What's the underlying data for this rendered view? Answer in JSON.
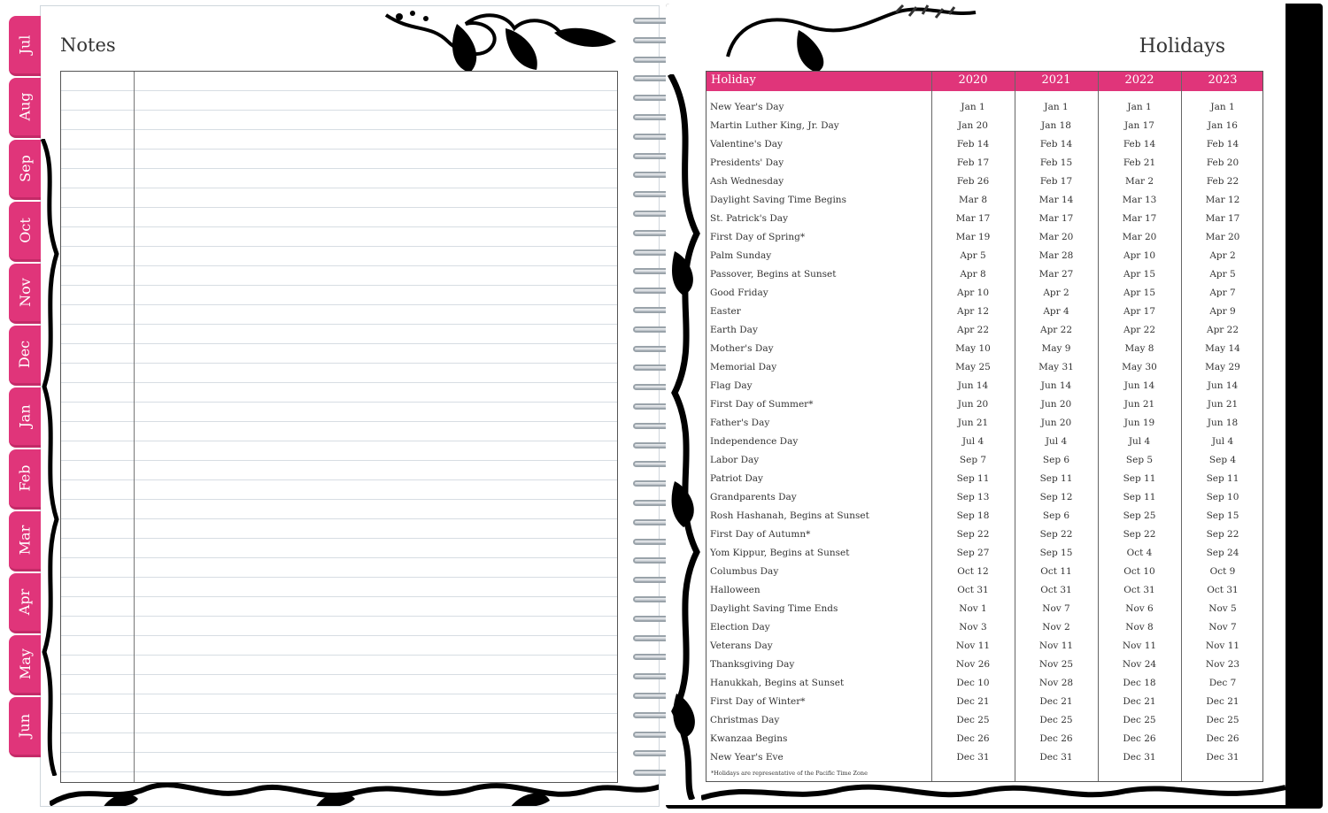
{
  "left_page": {
    "title": "Notes",
    "tabs": [
      "Jul",
      "Aug",
      "Sep",
      "Oct",
      "Nov",
      "Dec",
      "Jan",
      "Feb",
      "Mar",
      "Apr",
      "May",
      "Jun"
    ]
  },
  "right_page": {
    "title": "Holidays",
    "columns": [
      "Holiday",
      "2020",
      "2021",
      "2022",
      "2023"
    ],
    "rows": [
      [
        "New Year's Day",
        "Jan 1",
        "Jan 1",
        "Jan 1",
        "Jan 1"
      ],
      [
        "Martin Luther King, Jr. Day",
        "Jan 20",
        "Jan 18",
        "Jan 17",
        "Jan 16"
      ],
      [
        "Valentine's Day",
        "Feb 14",
        "Feb 14",
        "Feb 14",
        "Feb 14"
      ],
      [
        "Presidents' Day",
        "Feb 17",
        "Feb 15",
        "Feb 21",
        "Feb 20"
      ],
      [
        "Ash Wednesday",
        "Feb 26",
        "Feb 17",
        "Mar 2",
        "Feb 22"
      ],
      [
        "Daylight Saving Time Begins",
        "Mar 8",
        "Mar 14",
        "Mar 13",
        "Mar 12"
      ],
      [
        "St. Patrick's Day",
        "Mar 17",
        "Mar 17",
        "Mar 17",
        "Mar 17"
      ],
      [
        "First Day of Spring*",
        "Mar 19",
        "Mar 20",
        "Mar 20",
        "Mar 20"
      ],
      [
        "Palm Sunday",
        "Apr 5",
        "Mar 28",
        "Apr 10",
        "Apr 2"
      ],
      [
        "Passover, Begins at Sunset",
        "Apr 8",
        "Mar 27",
        "Apr 15",
        "Apr 5"
      ],
      [
        "Good Friday",
        "Apr 10",
        "Apr 2",
        "Apr 15",
        "Apr 7"
      ],
      [
        "Easter",
        "Apr 12",
        "Apr 4",
        "Apr 17",
        "Apr 9"
      ],
      [
        "Earth Day",
        "Apr 22",
        "Apr 22",
        "Apr 22",
        "Apr 22"
      ],
      [
        "Mother's Day",
        "May 10",
        "May 9",
        "May 8",
        "May 14"
      ],
      [
        "Memorial Day",
        "May 25",
        "May 31",
        "May 30",
        "May 29"
      ],
      [
        "Flag Day",
        "Jun 14",
        "Jun 14",
        "Jun 14",
        "Jun 14"
      ],
      [
        "First Day of Summer*",
        "Jun 20",
        "Jun 20",
        "Jun 21",
        "Jun 21"
      ],
      [
        "Father's Day",
        "Jun 21",
        "Jun 20",
        "Jun 19",
        "Jun 18"
      ],
      [
        "Independence Day",
        "Jul 4",
        "Jul 4",
        "Jul 4",
        "Jul 4"
      ],
      [
        "Labor Day",
        "Sep 7",
        "Sep 6",
        "Sep 5",
        "Sep 4"
      ],
      [
        "Patriot Day",
        "Sep 11",
        "Sep 11",
        "Sep 11",
        "Sep 11"
      ],
      [
        "Grandparents Day",
        "Sep 13",
        "Sep 12",
        "Sep 11",
        "Sep 10"
      ],
      [
        "Rosh Hashanah, Begins at Sunset",
        "Sep 18",
        "Sep 6",
        "Sep 25",
        "Sep 15"
      ],
      [
        "First Day of Autumn*",
        "Sep 22",
        "Sep 22",
        "Sep 22",
        "Sep 22"
      ],
      [
        "Yom Kippur, Begins at Sunset",
        "Sep 27",
        "Sep 15",
        "Oct 4",
        "Sep 24"
      ],
      [
        "Columbus Day",
        "Oct 12",
        "Oct 11",
        "Oct 10",
        "Oct 9"
      ],
      [
        "Halloween",
        "Oct 31",
        "Oct 31",
        "Oct 31",
        "Oct 31"
      ],
      [
        "Daylight Saving Time Ends",
        "Nov 1",
        "Nov 7",
        "Nov 6",
        "Nov 5"
      ],
      [
        "Election Day",
        "Nov 3",
        "Nov 2",
        "Nov 8",
        "Nov 7"
      ],
      [
        "Veterans Day",
        "Nov 11",
        "Nov 11",
        "Nov 11",
        "Nov 11"
      ],
      [
        "Thanksgiving Day",
        "Nov 26",
        "Nov 25",
        "Nov 24",
        "Nov 23"
      ],
      [
        "Hanukkah, Begins at Sunset",
        "Dec 10",
        "Nov 28",
        "Dec 18",
        "Dec 7"
      ],
      [
        "First Day of Winter*",
        "Dec 21",
        "Dec 21",
        "Dec 21",
        "Dec 21"
      ],
      [
        "Christmas Day",
        "Dec 25",
        "Dec 25",
        "Dec 25",
        "Dec 25"
      ],
      [
        "Kwanzaa Begins",
        "Dec 26",
        "Dec 26",
        "Dec 26",
        "Dec 26"
      ],
      [
        "New Year's Eve",
        "Dec 31",
        "Dec 31",
        "Dec 31",
        "Dec 31"
      ]
    ],
    "footnote": "*Holidays are representative of the Pacific Time Zone"
  },
  "colors": {
    "accent": "#e0357a",
    "ink": "#000000"
  }
}
